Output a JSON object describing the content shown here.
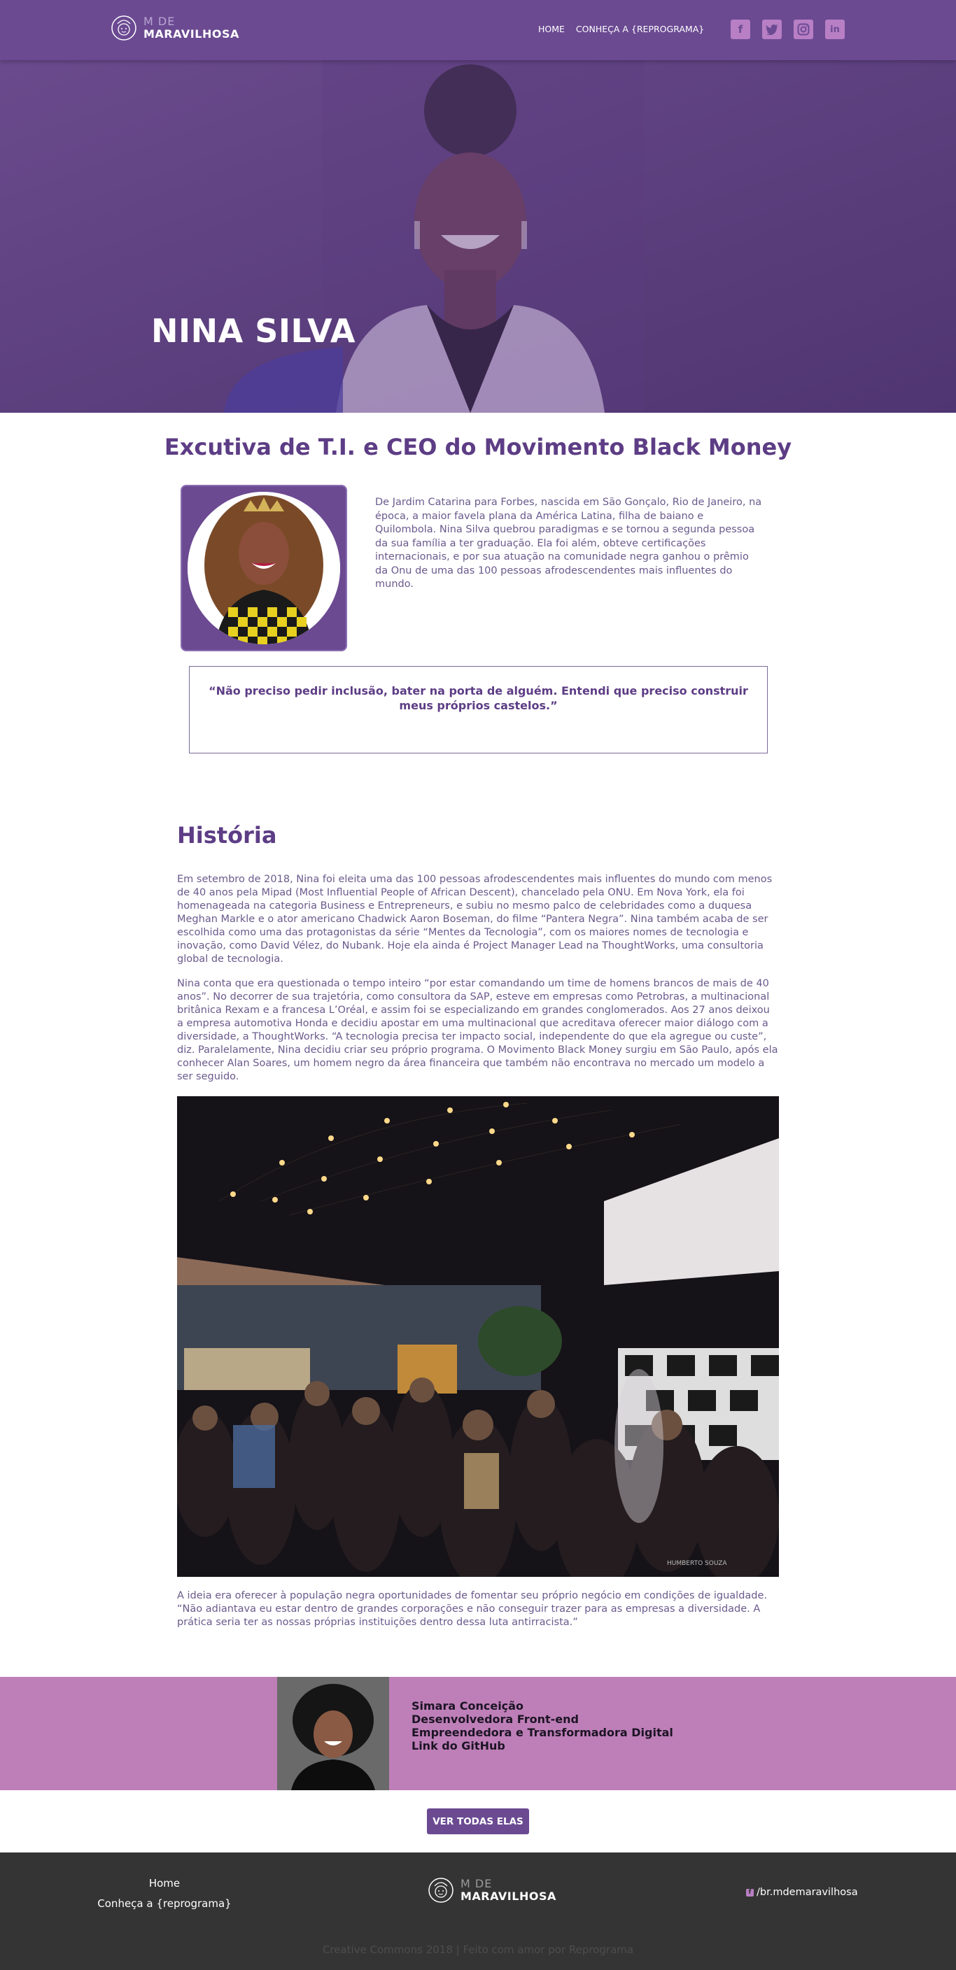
{
  "header": {
    "logo_small": "M DE",
    "logo_big": "MARAVILHOSA",
    "nav": [
      "HOME",
      "CONHEÇA A {REPROGRAMA}"
    ],
    "social": [
      "facebook-icon",
      "twitter-icon",
      "instagram-icon",
      "linkedin-icon"
    ]
  },
  "hero": {
    "name": "NINA SILVA"
  },
  "intro": {
    "subtitle": "Excutiva de T.I. e CEO do Movimento Black Money",
    "bio": "De Jardim Catarina para Forbes, nascida em São Gonçalo, Rio de Janeiro, na época, a maior favela plana da América Latina, filha de baiano e Quilombola. Nina Silva quebrou paradigmas e se tornou a segunda pessoa da sua família a ter graduação. Ela foi além, obteve certificações internacionais, e por sua atuação na comunidade negra ganhou o prêmio da Onu de uma das 100 pessoas afrodescendentes mais influentes do mundo.",
    "quote": "“Não preciso pedir inclusão, bater na porta de alguém. Entendi que preciso construir meus próprios castelos.”"
  },
  "historia": {
    "title": "História",
    "p1": "Em setembro de 2018, Nina foi eleita uma das 100 pessoas afrodescendentes mais influentes do mundo com menos de 40 anos pela Mipad (Most Influential People of African Descent), chancelado pela ONU. Em Nova York, ela foi homenageada na categoria Business e Entrepreneurs, e subiu no mesmo palco de celebridades como a duquesa Meghan Markle e o ator americano Chadwick Aaron Boseman, do filme “Pantera Negra”. Nina também acaba de ser escolhida como uma das protagonistas da série “Mentes da Tecnologia”, com os maiores nomes de tecnologia e inovação, como David Vélez, do Nubank. Hoje ela ainda é Project Manager Lead na ThoughtWorks, uma consultoria global de tecnologia.",
    "p2": "Nina conta que era questionada o tempo inteiro “por estar comandando um time de homens brancos de mais de 40 anos”. No decorrer de sua trajetória, como consultora da SAP, esteve em empresas como Petrobras, a multinacional britânica Rexam e a francesa L’Oréal, e assim foi se especializando em grandes conglomerados. Aos 27 anos deixou a empresa automotiva Honda e decidiu apostar em uma multinacional que acreditava oferecer maior diálogo com a diversidade, a ThoughtWorks. “A tecnologia precisa ter impacto social, independente do que ela agregue ou custe”, diz. Paralelamente, Nina decidiu criar seu próprio programa. O Movimento Black Money surgiu em São Paulo, após ela conhecer Alan Soares, um homem negro da área financeira que também não encontrava no mercado um modelo a ser seguido.",
    "p3": "A ideia era oferecer à população negra oportunidades de fomentar seu próprio negócio em condições de igualdade. “Não adiantava eu estar dentro de grandes corporações e não conseguir trazer para as empresas a diversidade. A prática seria ter as nossas próprias instituições dentro dessa luta antirracista.”",
    "photo_credit": "HUMBERTO SOUZA"
  },
  "author": {
    "name": "Simara Conceição",
    "role1": "Desenvolvedora Front-end",
    "role2": "Empreendedora e Transformadora Digital",
    "link": "Link do GitHub"
  },
  "cta": {
    "label": "VER TODAS ELAS"
  },
  "footer": {
    "nav": [
      "Home",
      "Conheça a {reprograma}"
    ],
    "logo_small": "M DE",
    "logo_big": "MARAVILHOSA",
    "social_text": "/br.mdemaravilhosa",
    "copyright": "Creative Commons 2018 | Feito com amor por Reprograma"
  },
  "colors": {
    "brand_purple": "#6b4a92",
    "accent_pink": "#be7fb8",
    "title_purple": "#5d3d85",
    "footer_bg": "#343434"
  }
}
